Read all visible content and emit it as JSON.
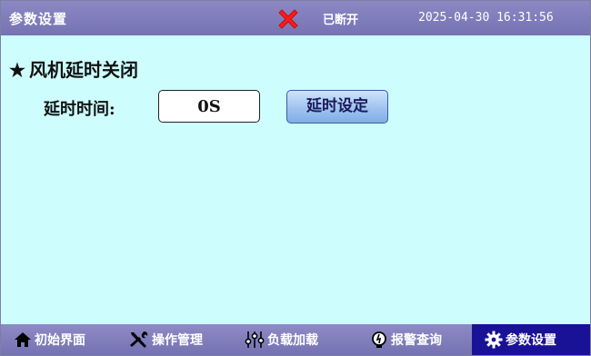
{
  "header": {
    "title": "参数设置",
    "connection_status": "已断开",
    "datetime": "2025-04-30 16:31:56",
    "status_color": "#ff0000"
  },
  "section": {
    "title": "风机延时关闭",
    "delay_label": "延时时间:",
    "delay_value": "0S",
    "set_button": "延时设定"
  },
  "nav": {
    "items": [
      {
        "label": "初始界面",
        "icon": "home-icon"
      },
      {
        "label": "操作管理",
        "icon": "tools-icon"
      },
      {
        "label": "负载加载",
        "icon": "sliders-icon"
      },
      {
        "label": "报警查询",
        "icon": "alarm-icon"
      },
      {
        "label": "参数设置",
        "icon": "gear-icon",
        "active": true
      }
    ]
  },
  "colors": {
    "header_bg": "#7f7dbb",
    "content_bg": "#cdfdfd",
    "active_tab": "#1a1296",
    "button_blue": "#9fc3ef"
  }
}
